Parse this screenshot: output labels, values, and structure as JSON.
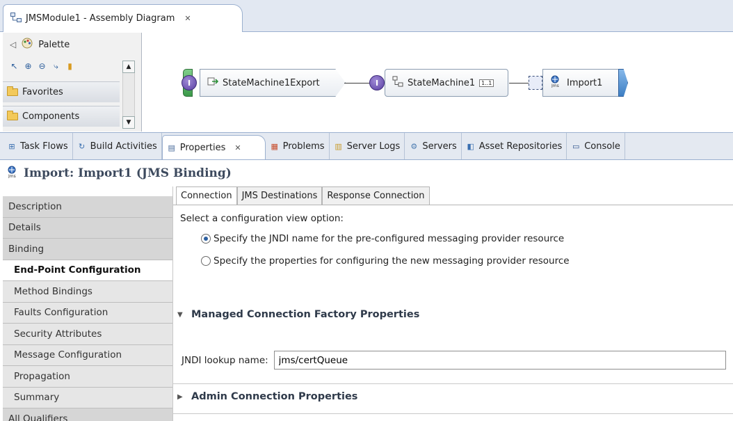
{
  "editor": {
    "tab_title": "JMSModule1 - Assembly Diagram"
  },
  "palette": {
    "title": "Palette",
    "drawers": [
      "Favorites",
      "Components"
    ]
  },
  "diagram": {
    "export_node": "StateMachine1Export",
    "component_node": "StateMachine1",
    "ref_multiplicity": "1..1",
    "import_node": "Import1",
    "interface_glyph": "I"
  },
  "views": {
    "tabs": [
      "Task Flows",
      "Build Activities",
      "Properties",
      "Problems",
      "Server Logs",
      "Servers",
      "Asset Repositories",
      "Console"
    ]
  },
  "properties": {
    "title": "Import: Import1 (JMS Binding)",
    "left_tabs": [
      "Description",
      "Details",
      "Binding",
      "End-Point Configuration",
      "Method Bindings",
      "Faults Configuration",
      "Security Attributes",
      "Message Configuration",
      "Propagation",
      "Summary",
      "All Qualifiers"
    ],
    "sub_tabs": [
      "Connection",
      "JMS Destinations",
      "Response Connection"
    ],
    "select_label": "Select a configuration view option:",
    "radio_jndi": "Specify the JNDI name for the pre-configured messaging provider resource",
    "radio_new": "Specify the properties for configuring the new messaging provider resource",
    "section_managed": "Managed Connection Factory Properties",
    "jndi_label": "JNDI lookup name:",
    "jndi_value": "jms/certQueue",
    "section_admin": "Admin Connection Properties"
  }
}
